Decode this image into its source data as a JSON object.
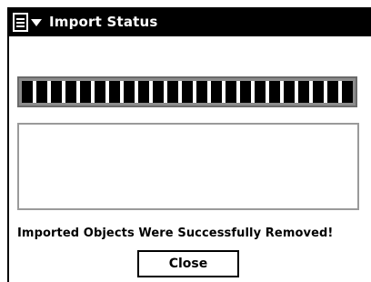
{
  "window": {
    "title": "Import Status",
    "menu_icon": "document-menu-icon"
  },
  "progress": {
    "fraction": 1.0
  },
  "status_box": {
    "text": ""
  },
  "message": "Imported Objects Were Successfully Removed!",
  "close_button": {
    "label": "Close"
  },
  "colors": {
    "titlebar_bg": "#000000",
    "titlebar_text": "#ffffff",
    "progress_frame": "#8c8c8c",
    "progress_segment": "#000000",
    "status_box_border": "#9a9a9a"
  }
}
